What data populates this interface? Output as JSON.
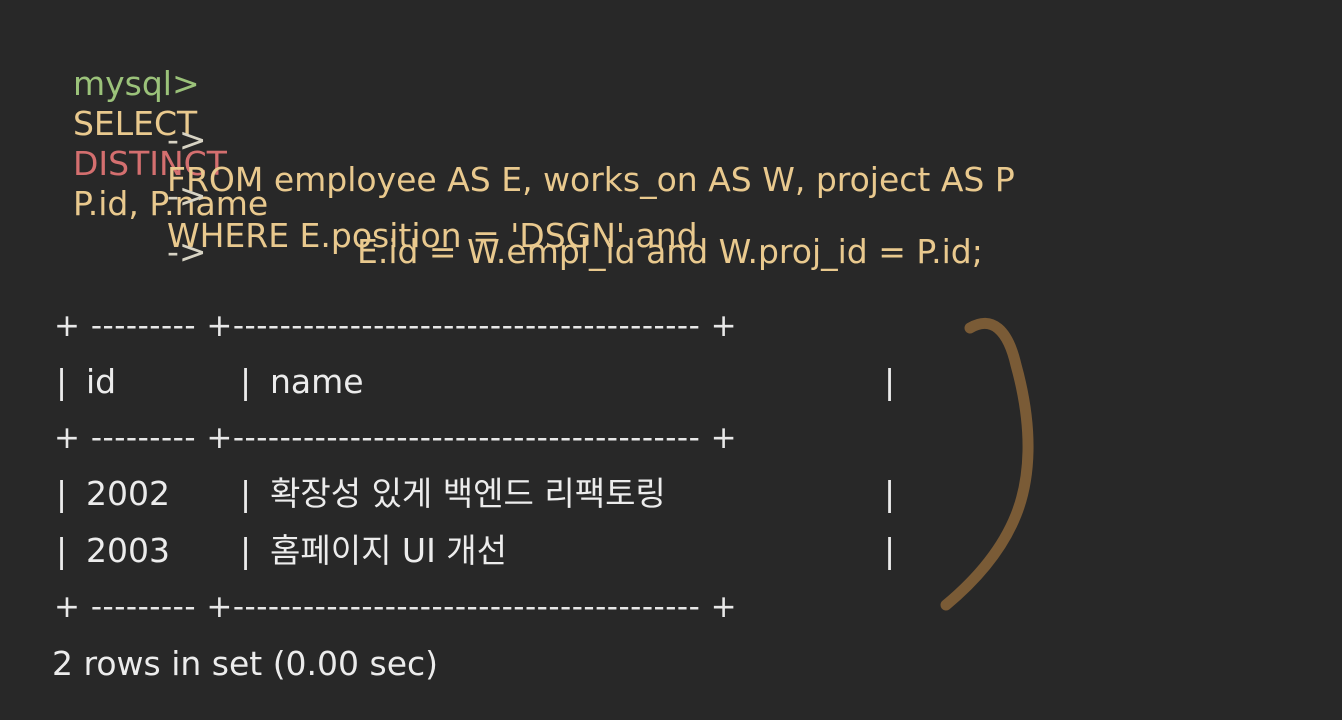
{
  "query": {
    "prompt": "mysql>",
    "line1_select": "SELECT",
    "line1_distinct": "DISTINCT",
    "line1_rest": "P.id, P.name",
    "continuation": "->",
    "line2": "FROM employee AS E, works_on AS W, project AS P",
    "line3": "WHERE E.position = 'DSGN' and",
    "line4": "E.id = W.empl_id and W.proj_id = P.id;"
  },
  "result": {
    "border": "+ --------- +---------------------------------------- +",
    "pipe": "|",
    "columns": [
      "id",
      "name"
    ],
    "rows": [
      {
        "id": "2002",
        "name": "확장성 있게 백엔드 리팩토링"
      },
      {
        "id": "2003",
        "name": "홈페이지 UI 개선"
      }
    ],
    "footer": "2 rows in set (0.00 sec)"
  },
  "annotation": {
    "color": "#7a5b36"
  }
}
